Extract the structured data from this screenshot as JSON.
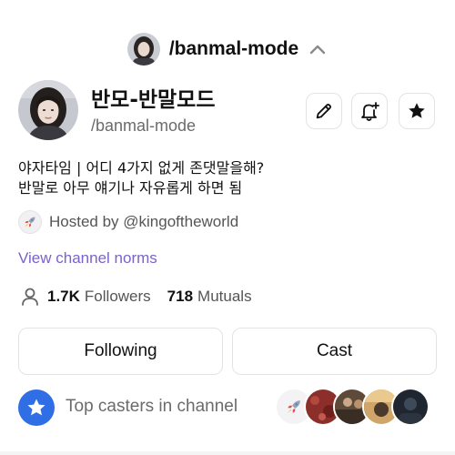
{
  "topbar": {
    "handle": "/banmal-mode",
    "collapse_icon": "chevron-up-icon"
  },
  "channel": {
    "name": "반모-반말모드",
    "handle": "/banmal-mode",
    "description_line1": "야자타임 | 어디 4가지 없게 존댓말을해?",
    "description_line2": "반말로 아무 얘기나 자유롭게 하면 됨",
    "hosted_by": "Hosted by @kingoftheworld",
    "norms_link": "View channel norms",
    "followers_count": "1.7K",
    "followers_label": "Followers",
    "mutuals_count": "718",
    "mutuals_label": "Mutuals"
  },
  "actions": {
    "edit_icon": "pencil-icon",
    "notify_icon": "bell-plus-icon",
    "favorite_icon": "star-icon",
    "following_label": "Following",
    "cast_label": "Cast"
  },
  "casters": {
    "label": "Top casters in channel",
    "badge_icon": "star-icon"
  },
  "colors": {
    "link": "#7b63c8",
    "badge_blue": "#2f6ee5",
    "border": "#e3e3e6",
    "muted_text": "#6b6b6b"
  }
}
